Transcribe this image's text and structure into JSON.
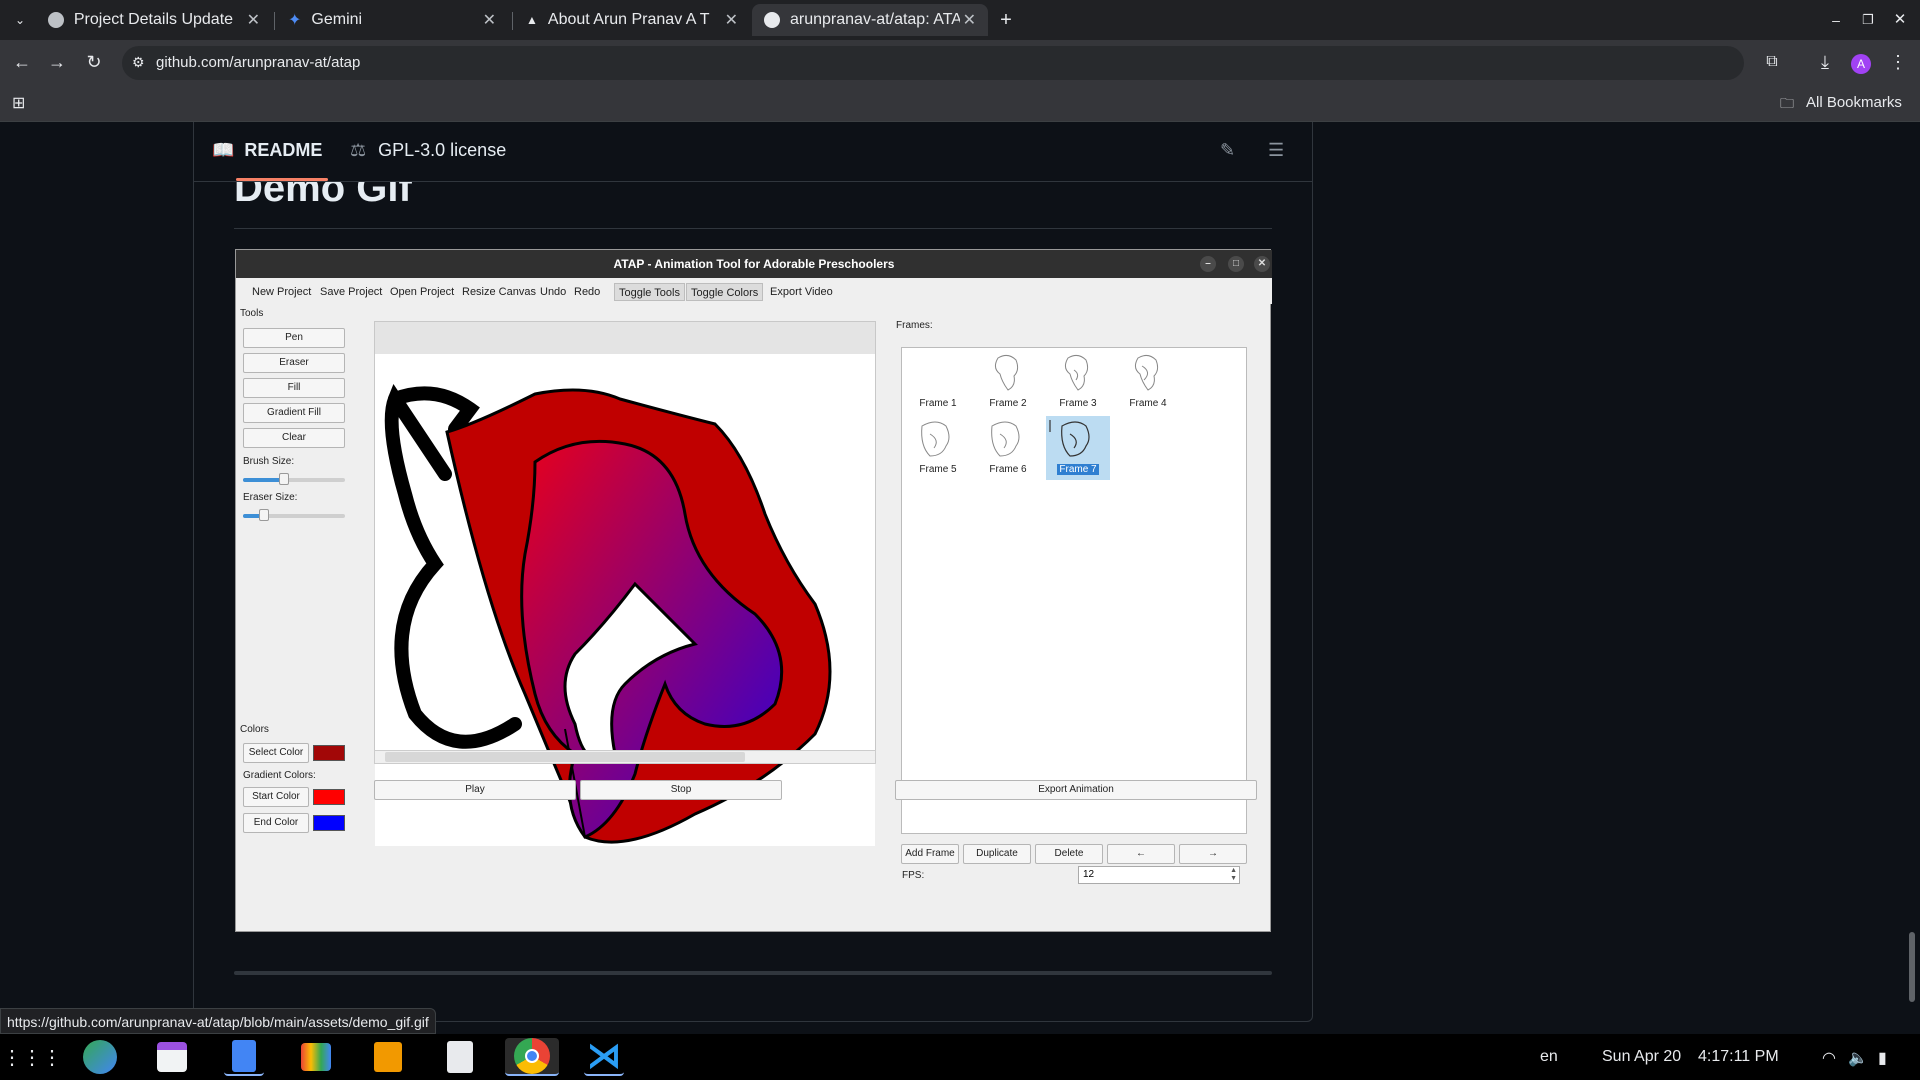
{
  "browser": {
    "tabs": [
      {
        "title": "Project Details Update",
        "active": false
      },
      {
        "title": "Gemini",
        "active": false
      },
      {
        "title": "About Arun Pranav A T",
        "active": false
      },
      {
        "title": "arunpranav-at/atap: ATAP",
        "active": true
      }
    ],
    "url": "github.com/arunpranav-at/atap",
    "bookmarks_label": "All Bookmarks",
    "profile_initial": "A",
    "status_url": "https://github.com/arunpranav-at/atap/blob/main/assets/demo_gif.gif"
  },
  "readme": {
    "tab_readme": "README",
    "tab_license": "GPL-3.0 license",
    "heading": "Demo Gif"
  },
  "app": {
    "title": "ATAP - Animation Tool for Adorable Preschoolers",
    "menu": [
      "New Project",
      "Save Project",
      "Open Project",
      "Resize Canvas",
      "Undo",
      "Redo",
      "Toggle Tools",
      "Toggle Colors",
      "Export Video"
    ],
    "tools_label": "Tools",
    "tools": [
      "Pen",
      "Eraser",
      "Fill",
      "Gradient Fill",
      "Clear"
    ],
    "brush_size_label": "Brush Size:",
    "brush_size_value": 0.4,
    "eraser_size_label": "Eraser Size:",
    "eraser_size_value": 0.2,
    "colors_label": "Colors",
    "select_color_label": "Select Color",
    "gradient_colors_label": "Gradient Colors:",
    "start_color_label": "Start Color",
    "end_color_label": "End Color",
    "select_color": "#a20707",
    "start_color": "#ff0000",
    "end_color": "#0000ff",
    "frames_label": "Frames:",
    "frames": [
      "Frame 1",
      "Frame 2",
      "Frame 3",
      "Frame 4",
      "Frame 5",
      "Frame 6",
      "Frame 7"
    ],
    "selected_frame": "Frame 7",
    "frame_buttons": [
      "Add Frame",
      "Duplicate",
      "Delete",
      "←",
      "→"
    ],
    "fps_label": "FPS:",
    "fps_value": "12",
    "play_label": "Play",
    "stop_label": "Stop",
    "export_animation_label": "Export Animation"
  },
  "taskbar": {
    "language": "en",
    "date": "Sun Apr 20",
    "time": "4:17:11 PM"
  }
}
